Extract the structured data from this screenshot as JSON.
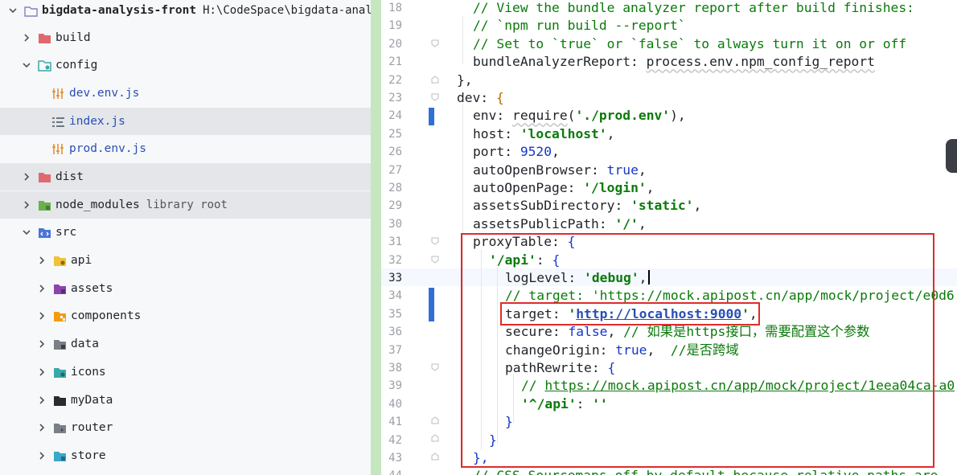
{
  "project_tree": {
    "root": {
      "name": "bigdata-analysis-front",
      "path": "H:\\CodeSpace\\bigdata-analys"
    },
    "items": [
      {
        "name": "build",
        "kind": "folder",
        "expanded": false
      },
      {
        "name": "config",
        "kind": "folder",
        "expanded": true
      },
      {
        "name": "dev.env.js",
        "kind": "file"
      },
      {
        "name": "index.js",
        "kind": "file"
      },
      {
        "name": "prod.env.js",
        "kind": "file"
      },
      {
        "name": "dist",
        "kind": "folder",
        "expanded": false
      },
      {
        "name": "node_modules",
        "kind": "folder",
        "expanded": false,
        "hint": "library root"
      },
      {
        "name": "src",
        "kind": "folder",
        "expanded": true
      },
      {
        "name": "api",
        "kind": "folder",
        "expanded": false
      },
      {
        "name": "assets",
        "kind": "folder",
        "expanded": false
      },
      {
        "name": "components",
        "kind": "folder",
        "expanded": false
      },
      {
        "name": "data",
        "kind": "folder",
        "expanded": false
      },
      {
        "name": "icons",
        "kind": "folder",
        "expanded": false
      },
      {
        "name": "myData",
        "kind": "folder",
        "expanded": false
      },
      {
        "name": "router",
        "kind": "folder",
        "expanded": false
      },
      {
        "name": "store",
        "kind": "folder",
        "expanded": false
      }
    ]
  },
  "editor": {
    "current_line": "33",
    "lines": [
      {
        "n": "18",
        "t": [
          [
            "// View the bundle analyzer report after build finishes:",
            "c"
          ]
        ]
      },
      {
        "n": "19",
        "t": [
          [
            "// `npm run build --report`",
            "c"
          ]
        ]
      },
      {
        "n": "20",
        "t": [
          [
            "// Set to `true` or `false` to always turn it on or off",
            "c"
          ]
        ]
      },
      {
        "n": "21",
        "t": [
          [
            "bundleAnalyzerReport",
            "prop"
          ],
          [
            ": ",
            "p"
          ],
          [
            "process.env.npm_config_report",
            "squig"
          ]
        ]
      },
      {
        "n": "22",
        "t": [
          [
            "},",
            "p"
          ]
        ]
      },
      {
        "n": "23",
        "t": [
          [
            "dev",
            "prop"
          ],
          [
            ": ",
            "p"
          ],
          [
            "{",
            "b-orange"
          ]
        ]
      },
      {
        "n": "24",
        "t": [
          [
            "env",
            "prop"
          ],
          [
            ": ",
            "p"
          ],
          [
            "require",
            "squig"
          ],
          [
            "(",
            "p"
          ],
          [
            "'./prod.env'",
            "s"
          ],
          [
            "),",
            "p"
          ]
        ]
      },
      {
        "n": "25",
        "t": [
          [
            "host",
            "prop"
          ],
          [
            ": ",
            "p"
          ],
          [
            "'localhost'",
            "s"
          ],
          [
            ",",
            "p"
          ]
        ]
      },
      {
        "n": "26",
        "t": [
          [
            "port",
            "prop"
          ],
          [
            ": ",
            "p"
          ],
          [
            "9520",
            "n"
          ],
          [
            ",",
            "p"
          ]
        ]
      },
      {
        "n": "27",
        "t": [
          [
            "autoOpenBrowser",
            "prop"
          ],
          [
            ": ",
            "p"
          ],
          [
            "true",
            "k"
          ],
          [
            ",",
            "p"
          ]
        ]
      },
      {
        "n": "28",
        "t": [
          [
            "autoOpenPage",
            "prop"
          ],
          [
            ": ",
            "p"
          ],
          [
            "'/login'",
            "s"
          ],
          [
            ",",
            "p"
          ]
        ]
      },
      {
        "n": "29",
        "t": [
          [
            "assetsSubDirectory",
            "prop"
          ],
          [
            ": ",
            "p"
          ],
          [
            "'static'",
            "s"
          ],
          [
            ",",
            "p"
          ]
        ]
      },
      {
        "n": "30",
        "t": [
          [
            "assetsPublicPath",
            "prop"
          ],
          [
            ": ",
            "p"
          ],
          [
            "'/'",
            "s"
          ],
          [
            ",",
            "p"
          ]
        ]
      },
      {
        "n": "31",
        "t": [
          [
            "proxyTable",
            "prop"
          ],
          [
            ": ",
            "p"
          ],
          [
            "{",
            "k"
          ]
        ]
      },
      {
        "n": "32",
        "t": [
          [
            "'/api'",
            "s"
          ],
          [
            ": ",
            "p"
          ],
          [
            "{",
            "k"
          ]
        ]
      },
      {
        "n": "33",
        "t": [
          [
            "logLevel",
            "prop"
          ],
          [
            ": ",
            "p"
          ],
          [
            "'debug'",
            "s"
          ],
          [
            ",",
            "p"
          ]
        ]
      },
      {
        "n": "34",
        "t": [
          [
            "// target: 'https://mock.apipost.cn/app/mock/project/e0d6",
            "c"
          ]
        ]
      },
      {
        "n": "35",
        "t": [
          [
            "target",
            "prop"
          ],
          [
            ": ",
            "p"
          ],
          [
            "'",
            "s"
          ],
          [
            "http://localhost:9000",
            "url-blue"
          ],
          [
            "'",
            "s"
          ],
          [
            ",",
            "p"
          ]
        ]
      },
      {
        "n": "36",
        "t": [
          [
            "secure",
            "prop"
          ],
          [
            ": ",
            "p"
          ],
          [
            "false",
            "k"
          ],
          [
            ", ",
            "p"
          ],
          [
            "// 如果是https接口，需要配置这个参数",
            "c"
          ]
        ]
      },
      {
        "n": "37",
        "t": [
          [
            "changeOrigin",
            "prop"
          ],
          [
            ": ",
            "p"
          ],
          [
            "true",
            "k"
          ],
          [
            ",  ",
            "p"
          ],
          [
            "//是否跨域",
            "c"
          ]
        ]
      },
      {
        "n": "38",
        "t": [
          [
            "pathRewrite",
            "prop"
          ],
          [
            ": ",
            "p"
          ],
          [
            "{",
            "k"
          ]
        ]
      },
      {
        "n": "39",
        "t": [
          [
            "// ",
            "c"
          ],
          [
            "https://mock.apipost.cn/app/mock/project/1eea04ca-a0",
            "url"
          ]
        ]
      },
      {
        "n": "40",
        "t": [
          [
            "'^/api'",
            "s"
          ],
          [
            ": ",
            "p"
          ],
          [
            "''",
            "s"
          ]
        ]
      },
      {
        "n": "41",
        "t": [
          [
            "}",
            "k"
          ]
        ]
      },
      {
        "n": "42",
        "t": [
          [
            "}",
            "k"
          ]
        ]
      },
      {
        "n": "43",
        "t": [
          [
            "},",
            "k"
          ]
        ]
      },
      {
        "n": "44",
        "t": [
          [
            "// CSS Sourcemaps off by default because relative paths are",
            "c"
          ]
        ]
      }
    ]
  },
  "icon_colors": {
    "folder_plain": "#9aa3ad",
    "folder_pink": "#e0686e",
    "folder_teal": "#3aa8a8",
    "folder_green": "#6ab04c",
    "folder_blue": "#4a74d8",
    "folder_yellow": "#f0c23a",
    "folder_purple": "#8e44ad",
    "folder_orange": "#f39c12",
    "folder_grey": "#7a7f87",
    "folder_black": "#2b2b2b",
    "file_orange": "#e08a2a",
    "file_grey": "#6e7681"
  }
}
